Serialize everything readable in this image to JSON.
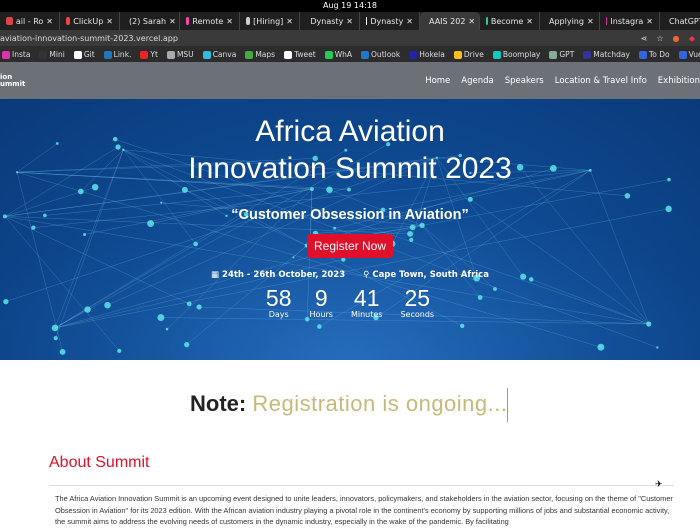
{
  "os": {
    "clock": "Aug 19  14:18"
  },
  "tabs": [
    {
      "label": "ail - Ro",
      "icon": "mail-icon",
      "color": "#d44"
    },
    {
      "label": "ClickUp",
      "icon": "gmail-icon",
      "color": "#e44"
    },
    {
      "label": "(2) Sarah",
      "icon": "x-icon",
      "color": "#fff"
    },
    {
      "label": "Remote",
      "icon": "emoji-icon",
      "color": "#f4a"
    },
    {
      "label": "[Hiring]",
      "icon": "globe-icon",
      "color": "#ccc"
    },
    {
      "label": "Dynasty",
      "icon": "blank-icon",
      "color": "transparent"
    },
    {
      "label": "Dynasty",
      "icon": "github-icon",
      "color": "#fff"
    },
    {
      "label": "AAIS 202",
      "icon": "africa-icon",
      "color": "#c93",
      "active": true
    },
    {
      "label": "Become",
      "icon": "circle-icon",
      "color": "#2c9"
    },
    {
      "label": "Applying",
      "icon": "page-icon",
      "color": "#ccc"
    },
    {
      "label": "Instagra",
      "icon": "instagram-icon",
      "color": "#d3a"
    },
    {
      "label": "ChatGPT",
      "icon": "chatgpt-icon",
      "color": "#7a9"
    }
  ],
  "address": {
    "url": "aviation-innovation-summit-2023.vercel.app"
  },
  "bookmarks": [
    {
      "label": "Insta",
      "color": "#d3a"
    },
    {
      "label": "Mini",
      "color": "#333"
    },
    {
      "label": "Git",
      "color": "#fff"
    },
    {
      "label": "Link.",
      "color": "#27b"
    },
    {
      "label": "Yt",
      "color": "#e22"
    },
    {
      "label": "MSU",
      "color": "#aaa"
    },
    {
      "label": "Canva",
      "color": "#3bd"
    },
    {
      "label": "Maps",
      "color": "#4a4"
    },
    {
      "label": "Tweet",
      "color": "#fff"
    },
    {
      "label": "WhA",
      "color": "#2c5"
    },
    {
      "label": "Outlook",
      "color": "#27c"
    },
    {
      "label": "Hokela",
      "color": "#22a"
    },
    {
      "label": "Drive",
      "color": "#fb2"
    },
    {
      "label": "Boomplay",
      "color": "#1cb"
    },
    {
      "label": "GPT",
      "color": "#8a9"
    },
    {
      "label": "Matchday",
      "color": "#339"
    },
    {
      "label": "To Do",
      "color": "#36d"
    },
    {
      "label": "VueDocs",
      "color": "#36d"
    }
  ],
  "site": {
    "logo": [
      "ion",
      "ummit"
    ],
    "nav": [
      "Home",
      "Agenda",
      "Speakers",
      "Location & Travel Info",
      "Exhibition"
    ],
    "hero": {
      "title_line1": "Africa Aviation",
      "title_line2": "Innovation Summit 2023",
      "theme": "“Customer Obsession in Aviation”",
      "register": "Register Now",
      "date": "24th - 26th October, 2023",
      "location": "Cape Town, South Africa",
      "countdown": [
        {
          "n": "58",
          "l": "Days"
        },
        {
          "n": "9",
          "l": "Hours"
        },
        {
          "n": "41",
          "l": "Minutes"
        },
        {
          "n": "25",
          "l": "Seconds"
        }
      ]
    },
    "note": {
      "label": "Note:",
      "text": "Registration is ongoing..."
    },
    "about": {
      "heading": "About Summit",
      "text": "The Africa Aviation Innovation Summit is an upcoming event designed to unite leaders, innovators, policymakers, and stakeholders in the aviation sector, focusing on the theme of \"Customer Obsession in Aviation\" for its 2023 edition. With the African aviation industry playing a pivotal role in the continent's economy by supporting millions of jobs and substantial economic activity, the summit aims to address the evolving needs of customers in the dynamic industry, especially in the wake of the pandemic. By facilitating"
    }
  }
}
